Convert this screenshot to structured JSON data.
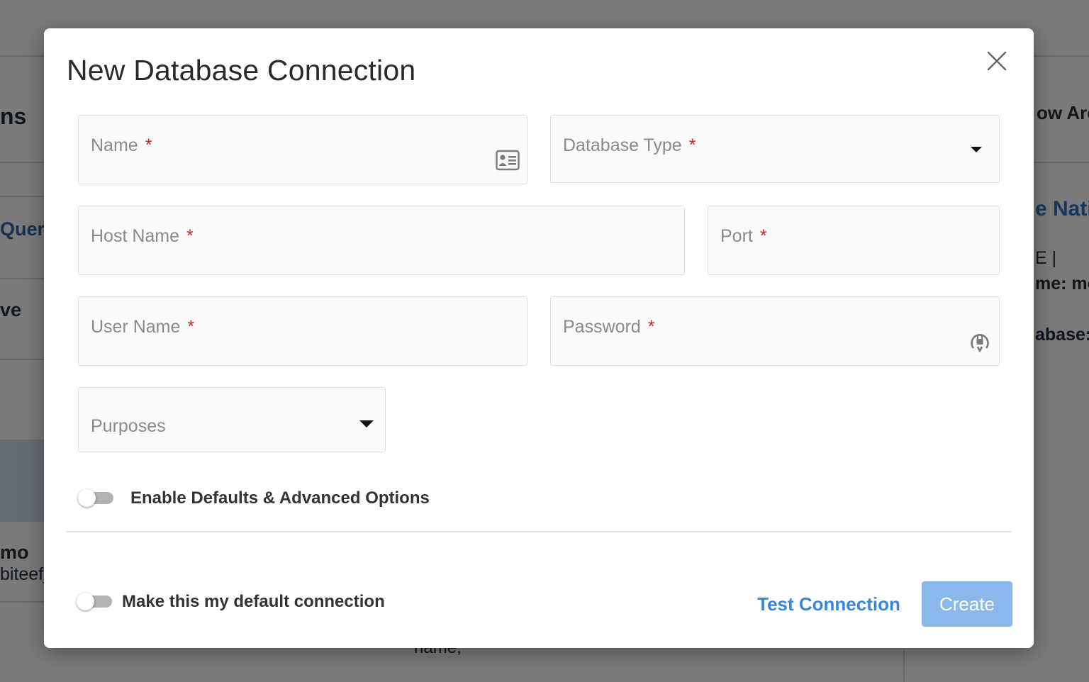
{
  "background": {
    "texts": [
      "ns",
      "Query",
      "ve",
      "mo",
      "biteefj",
      "ow Arch",
      "e Nati",
      "E |",
      "me: mo",
      "abase:",
      "name,"
    ]
  },
  "modal": {
    "title": "New Database Connection",
    "fields": {
      "name": {
        "label": "Name",
        "required_mark": "*",
        "value": ""
      },
      "database_type": {
        "label": "Database Type",
        "required_mark": "*",
        "value": ""
      },
      "host_name": {
        "label": "Host Name",
        "required_mark": "*",
        "value": ""
      },
      "port": {
        "label": "Port",
        "required_mark": "*",
        "value": ""
      },
      "user_name": {
        "label": "User Name",
        "required_mark": "*",
        "value": ""
      },
      "password": {
        "label": "Password",
        "required_mark": "*",
        "value": ""
      },
      "purposes": {
        "label": "Purposes",
        "value": ""
      }
    },
    "advanced_toggle": {
      "label": "Enable Defaults & Advanced Options",
      "on": false
    },
    "default_toggle": {
      "label": "Make this my default connection",
      "on": false
    },
    "buttons": {
      "test_connection": "Test Connection",
      "create": "Create"
    },
    "colors": {
      "primary": "#3a87d8",
      "create_disabled": "#8bb8ea",
      "required": "#c62828"
    },
    "icons": {
      "name": "id-card-icon",
      "password": "lock-refresh-icon",
      "close": "close-icon",
      "dropdown": "caret-down-icon"
    }
  }
}
